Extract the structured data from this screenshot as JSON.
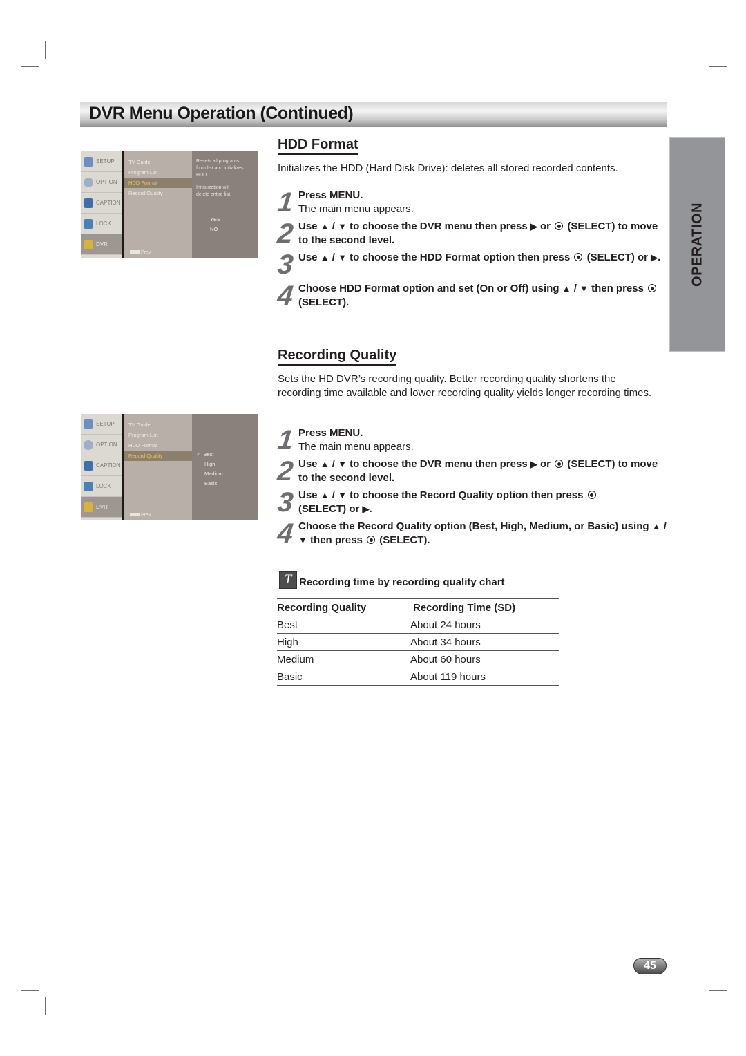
{
  "page": {
    "title": "DVR Menu Operation (Continued)",
    "side_tab": "OPERATION",
    "page_number": "45"
  },
  "hdd_format": {
    "heading": "HDD Format",
    "description": "Initializes the HDD (Hard Disk Drive): deletes all stored recorded contents.",
    "steps": [
      {
        "number": "1",
        "bold": "Press MENU.",
        "normal": "The main menu appears."
      },
      {
        "number": "2",
        "parts": [
          "Use ",
          "▲",
          " / ",
          "▼",
          " to choose the DVR menu then press ",
          "▶",
          " or ",
          " (SELECT) to move to the second level."
        ]
      },
      {
        "number": "3",
        "parts": [
          "Use ",
          "▲",
          " / ",
          "▼",
          " to choose the HDD Format option then press ",
          " (SELECT) or ",
          "▶",
          "."
        ]
      },
      {
        "number": "4",
        "parts": [
          "Choose HDD Format option and set (On or Off) using ",
          "▲",
          " / ",
          "▼",
          " then press ",
          " (SELECT)."
        ]
      }
    ],
    "menu_screenshot": {
      "left_items": [
        "SETUP",
        "OPTION",
        "CAPTION",
        "LOCK",
        "DVR"
      ],
      "active_left": "DVR",
      "mid_items": [
        "TV Guide",
        "Program List",
        "HDD Format",
        "Record Quality"
      ],
      "selected_mid": "HDD Format",
      "help_text": [
        "Resets all programs",
        "from list and initializes",
        "HDD.",
        "",
        "Initialization will",
        "delete entire list."
      ],
      "options": [
        "YES",
        "NO"
      ],
      "footer": "Prev"
    }
  },
  "recording_quality": {
    "heading": "Recording Quality",
    "description": "Sets the HD DVR’s recording quality. Better recording quality shortens the recording time available and lower recording quality yields longer recording times.",
    "steps": [
      {
        "number": "1",
        "bold": "Press MENU.",
        "normal": "The main menu appears."
      },
      {
        "number": "2",
        "parts": [
          "Use ",
          "▲",
          " / ",
          "▼",
          " to choose the DVR menu then press ",
          "▶",
          " or ",
          " (SELECT) to move to the second level."
        ]
      },
      {
        "number": "3",
        "parts": [
          "Use ",
          "▲",
          " / ",
          "▼",
          " to choose the Record Quality option then press ",
          " (SELECT) or ",
          "▶",
          "."
        ]
      },
      {
        "number": "4",
        "parts": [
          "Choose the Record Quality option (Best, High, Medium, or Basic) using ",
          "▲",
          " / ",
          "▼",
          " then press ",
          " (SELECT)."
        ]
      }
    ],
    "menu_screenshot": {
      "left_items": [
        "SETUP",
        "OPTION",
        "CAPTION",
        "LOCK",
        "DVR"
      ],
      "active_left": "DVR",
      "mid_items": [
        "TV Guide",
        "Program List",
        "HDD Format",
        "Record Quality"
      ],
      "selected_mid": "Record Quality",
      "options": [
        "Best",
        "High",
        "Medium",
        "Basic"
      ],
      "checked_option": "Best",
      "check_mark": "✓",
      "footer": "Prev"
    },
    "note_icon": "T",
    "note_title": "Recording time by recording quality chart",
    "table": {
      "headers": [
        "Recording Quality",
        "Recording Time (SD)"
      ],
      "rows": [
        [
          "Best",
          "About 24 hours"
        ],
        [
          "High",
          "About 34 hours"
        ],
        [
          "Medium",
          "About 60 hours"
        ],
        [
          "Basic",
          "About 119 hours"
        ]
      ]
    }
  }
}
